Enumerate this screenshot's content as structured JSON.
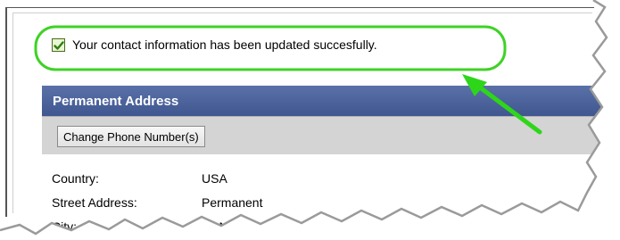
{
  "notification": {
    "message": "Your contact information has been updated succesfully.",
    "icon": "checkbox-checked-icon",
    "highlight_color": "#3fd226"
  },
  "panel": {
    "title": "Permanent Address",
    "header_color": "#4a62a0",
    "change_phone_label": "Change Phone Number(s)"
  },
  "fields": [
    {
      "label": "Country:",
      "value": "USA"
    },
    {
      "label": "Street Address:",
      "value": "Permanent"
    },
    {
      "label": "City:",
      "value": "HAN"
    }
  ]
}
